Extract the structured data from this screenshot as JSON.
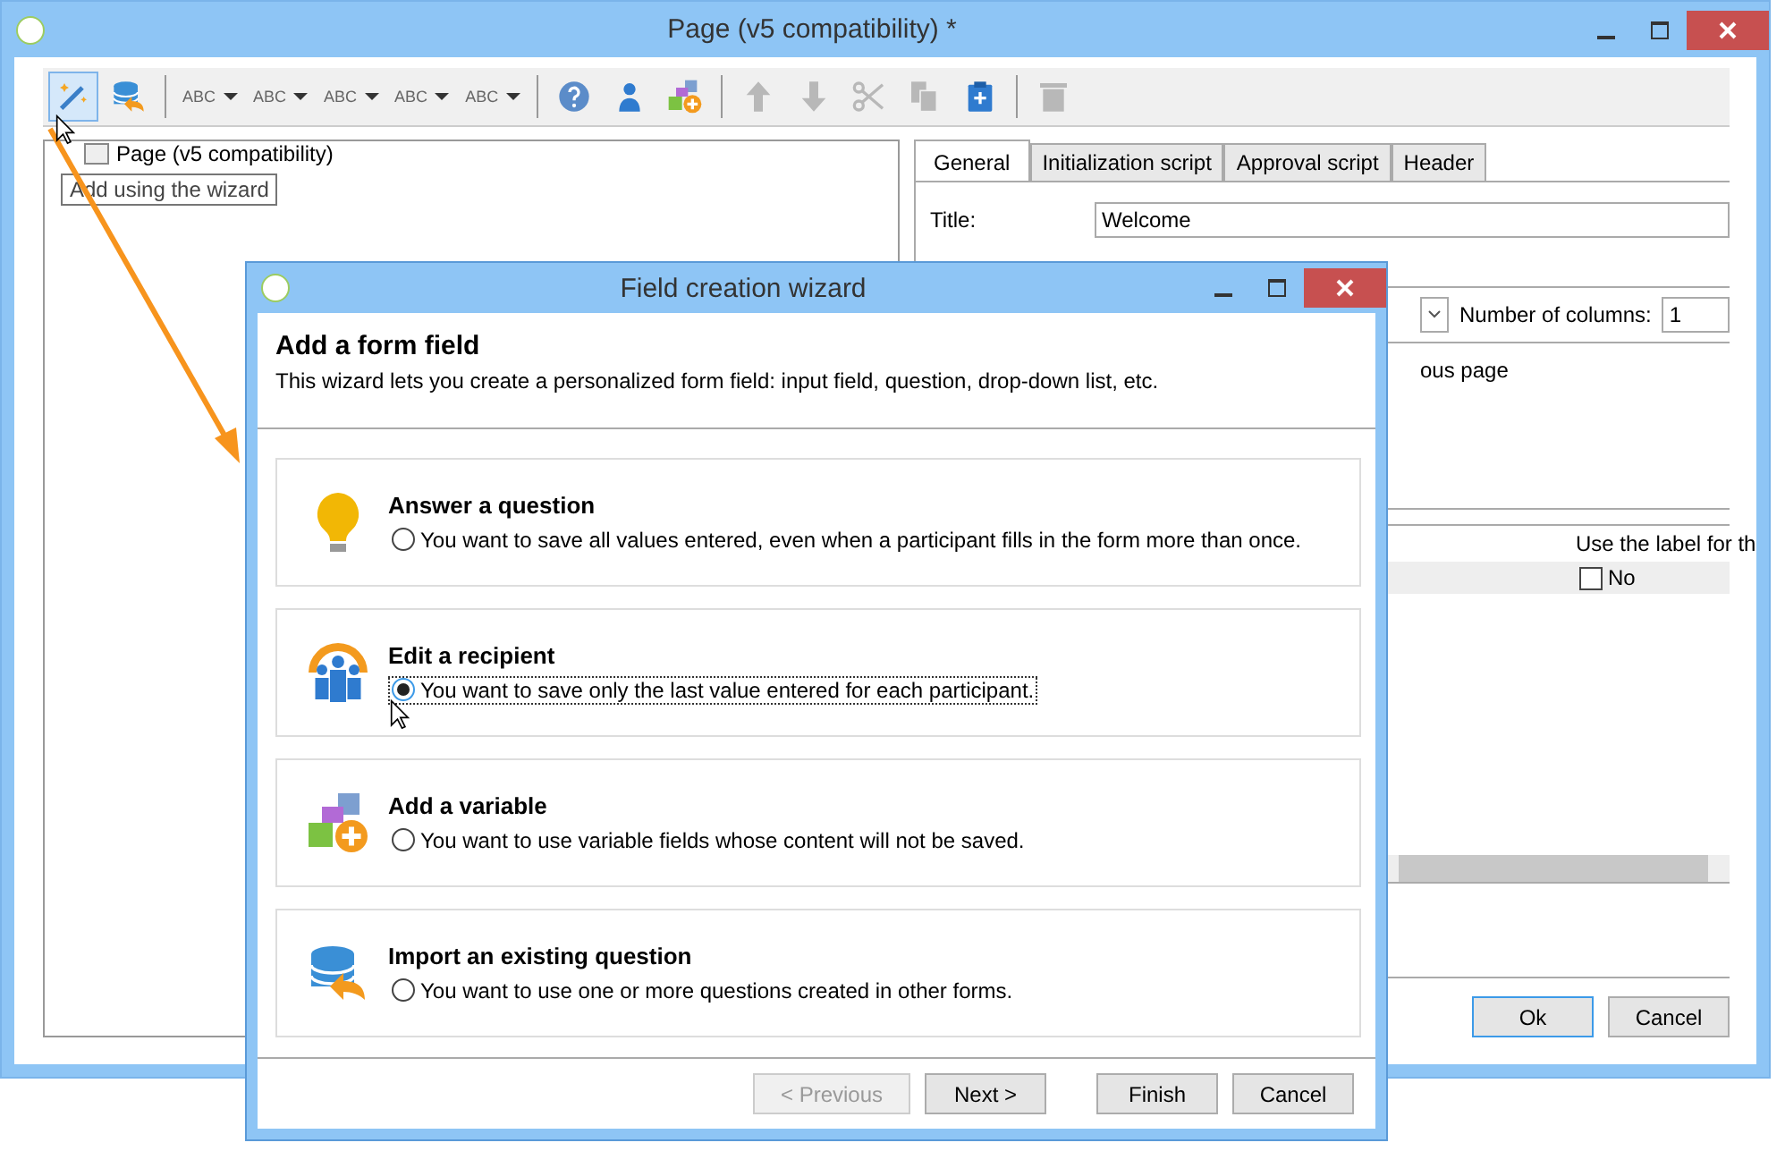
{
  "window": {
    "title": "Page (v5 compatibility) *"
  },
  "toolbar": [
    {
      "kind": "wand",
      "highlighted": true,
      "disabled": false
    },
    {
      "kind": "db-import",
      "highlighted": false,
      "disabled": false
    },
    {
      "kind": "separator"
    },
    {
      "kind": "text-dropdown",
      "label": "ABC",
      "highlighted": false,
      "disabled": false
    },
    {
      "kind": "text-dropdown",
      "label": "ABC",
      "highlighted": false,
      "disabled": false
    },
    {
      "kind": "text-dropdown",
      "label": "ABC",
      "highlighted": false,
      "disabled": false
    },
    {
      "kind": "text-dropdown",
      "label": "ABC",
      "highlighted": false,
      "disabled": false
    },
    {
      "kind": "text-dropdown",
      "label": "ABC",
      "highlighted": false,
      "disabled": false
    },
    {
      "kind": "separator"
    },
    {
      "kind": "help",
      "highlighted": false,
      "disabled": false
    },
    {
      "kind": "person",
      "highlighted": false,
      "disabled": false
    },
    {
      "kind": "add-variable",
      "highlighted": false,
      "disabled": false
    },
    {
      "kind": "separator"
    },
    {
      "kind": "up",
      "highlighted": false,
      "disabled": true
    },
    {
      "kind": "down",
      "highlighted": false,
      "disabled": true
    },
    {
      "kind": "scissors",
      "highlighted": false,
      "disabled": true
    },
    {
      "kind": "copy",
      "highlighted": false,
      "disabled": true
    },
    {
      "kind": "paste",
      "highlighted": false,
      "disabled": false
    },
    {
      "kind": "separator"
    },
    {
      "kind": "delete",
      "highlighted": false,
      "disabled": true
    }
  ],
  "tooltip": {
    "text": "Add using the wizard"
  },
  "tree": [
    {
      "label": "Page (v5 compatibility)"
    }
  ],
  "tabs": [
    {
      "label": "General",
      "selected": true
    },
    {
      "label": "Initialization script",
      "selected": false
    },
    {
      "label": "Approval script",
      "selected": false
    },
    {
      "label": "Header",
      "selected": false
    }
  ],
  "form": {
    "title_label": "Title:",
    "title_value": "Welcome",
    "columns_label": "Number of columns:",
    "columns_value": "1",
    "partial_label": "ous page"
  },
  "grid": {
    "column_header": "Use the label for th",
    "rows": [
      {
        "label": "No",
        "checked": false
      }
    ]
  },
  "buttons": [
    {
      "label": "Ok",
      "default": true
    },
    {
      "label": "Cancel",
      "default": false
    }
  ],
  "wizard": {
    "title": "Field creation wizard",
    "heading": "Add a form field",
    "description": "This wizard lets you create a personalized form field: input field, question, drop-down list, etc.",
    "options": [
      {
        "kind": "bulb",
        "title": "Answer a question",
        "description": "You want to save all values entered, even when a participant fills in the form more than once.",
        "selected": false
      },
      {
        "kind": "group",
        "title": "Edit a recipient",
        "description": "You want to save only the last value entered for each participant.",
        "selected": true
      },
      {
        "kind": "variable",
        "title": "Add a variable",
        "description": "You want to use variable fields whose content will not be saved.",
        "selected": false
      },
      {
        "kind": "import",
        "title": "Import an existing question",
        "description": "You want to use one or more questions created in other forms.",
        "selected": false
      }
    ],
    "buttons": [
      {
        "label": "< Previous",
        "disabled": true
      },
      {
        "label": "Next >",
        "disabled": false
      },
      {
        "label": "Finish",
        "disabled": false
      },
      {
        "label": "Cancel",
        "disabled": false
      }
    ]
  }
}
